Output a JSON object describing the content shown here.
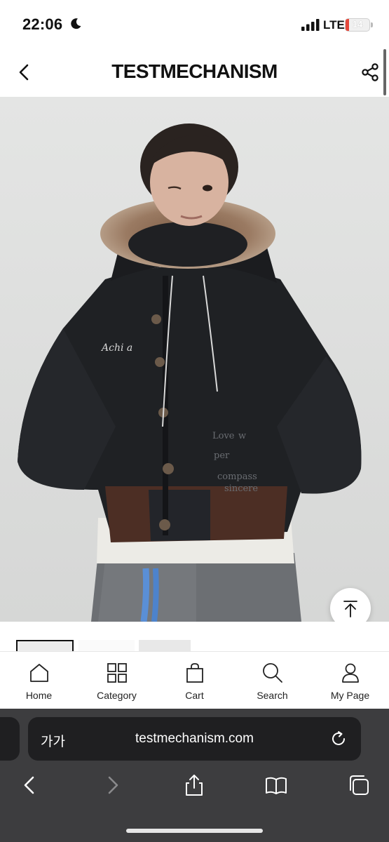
{
  "status_bar": {
    "time": "22:06",
    "moon_icon": "moon-icon",
    "signal_icon": "signal-bars-icon",
    "network": "LTE",
    "battery": "14",
    "battery_color": "#e5483c"
  },
  "header": {
    "back_icon": "chevron-left-icon",
    "brand": "TESTMECHANISM",
    "share_icon": "share-icon"
  },
  "product": {
    "image_icon": "product-photo",
    "scroll_top_icon": "arrow-up-to-top-icon",
    "thumbnails": [
      "thumbnail-1",
      "thumbnail-2",
      "thumbnail-3"
    ]
  },
  "bottom_nav": {
    "items": [
      {
        "label": "Home",
        "icon": "home-icon"
      },
      {
        "label": "Category",
        "icon": "grid-icon"
      },
      {
        "label": "Cart",
        "icon": "shopping-bag-icon"
      },
      {
        "label": "Search",
        "icon": "search-icon"
      },
      {
        "label": "My Page",
        "icon": "user-icon"
      }
    ]
  },
  "browser": {
    "text_size": "가가",
    "url": "testmechanism.com",
    "reload_icon": "reload-icon",
    "toolbar": [
      "back-icon",
      "forward-icon",
      "share-icon",
      "bookmarks-icon",
      "tabs-icon"
    ]
  }
}
